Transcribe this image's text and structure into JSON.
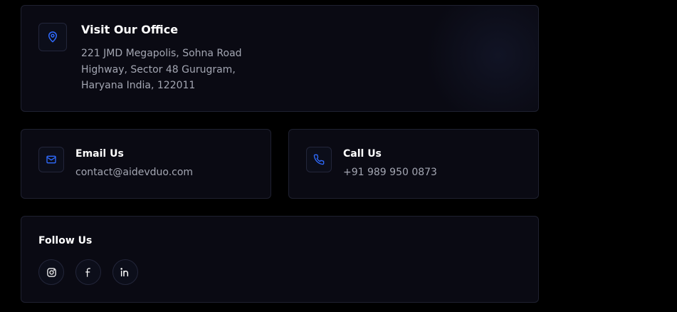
{
  "office": {
    "title": "Visit Our Office",
    "address_lines": [
      "221 JMD Megapolis, Sohna Road",
      "Highway, Sector 48 Gurugram,",
      "Haryana India, 122011"
    ],
    "icon": "map-pin-icon"
  },
  "email": {
    "title": "Email Us",
    "value": "contact@aidevduo.com",
    "icon": "mail-icon"
  },
  "call": {
    "title": "Call Us",
    "value": "+91 989 950 0873",
    "icon": "phone-icon"
  },
  "follow": {
    "title": "Follow Us",
    "links": [
      {
        "name": "instagram",
        "icon": "instagram-icon"
      },
      {
        "name": "facebook",
        "icon": "facebook-icon"
      },
      {
        "name": "linkedin",
        "icon": "linkedin-icon"
      }
    ]
  },
  "colors": {
    "accent": "#2f6bff",
    "card_bg": "#0a0a13",
    "border": "#1f2130",
    "page_bg": "#000000"
  }
}
